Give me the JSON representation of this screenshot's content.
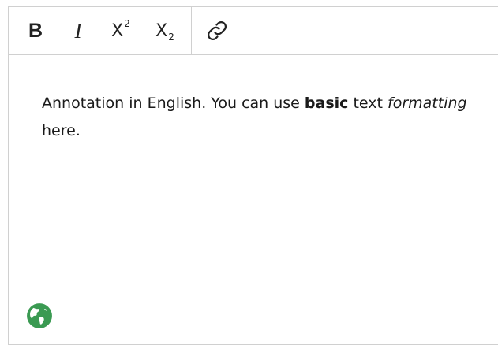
{
  "toolbar": {
    "bold_label": "B",
    "italic_label": "I",
    "superscript_label": "X",
    "superscript_mark": "2",
    "subscript_label": "X",
    "subscript_mark": "2"
  },
  "content": {
    "text_before": "Annotation in English. You can use ",
    "bold_text": "basic",
    "text_middle": " text ",
    "italic_text": "formatting",
    "text_after": " here."
  },
  "footer": {
    "language_icon": "globe-icon",
    "icon_color": "#3a9a52"
  },
  "colors": {
    "border": "#d0d0d0",
    "text": "#1a1a1a",
    "globe_green": "#3a9a52"
  }
}
